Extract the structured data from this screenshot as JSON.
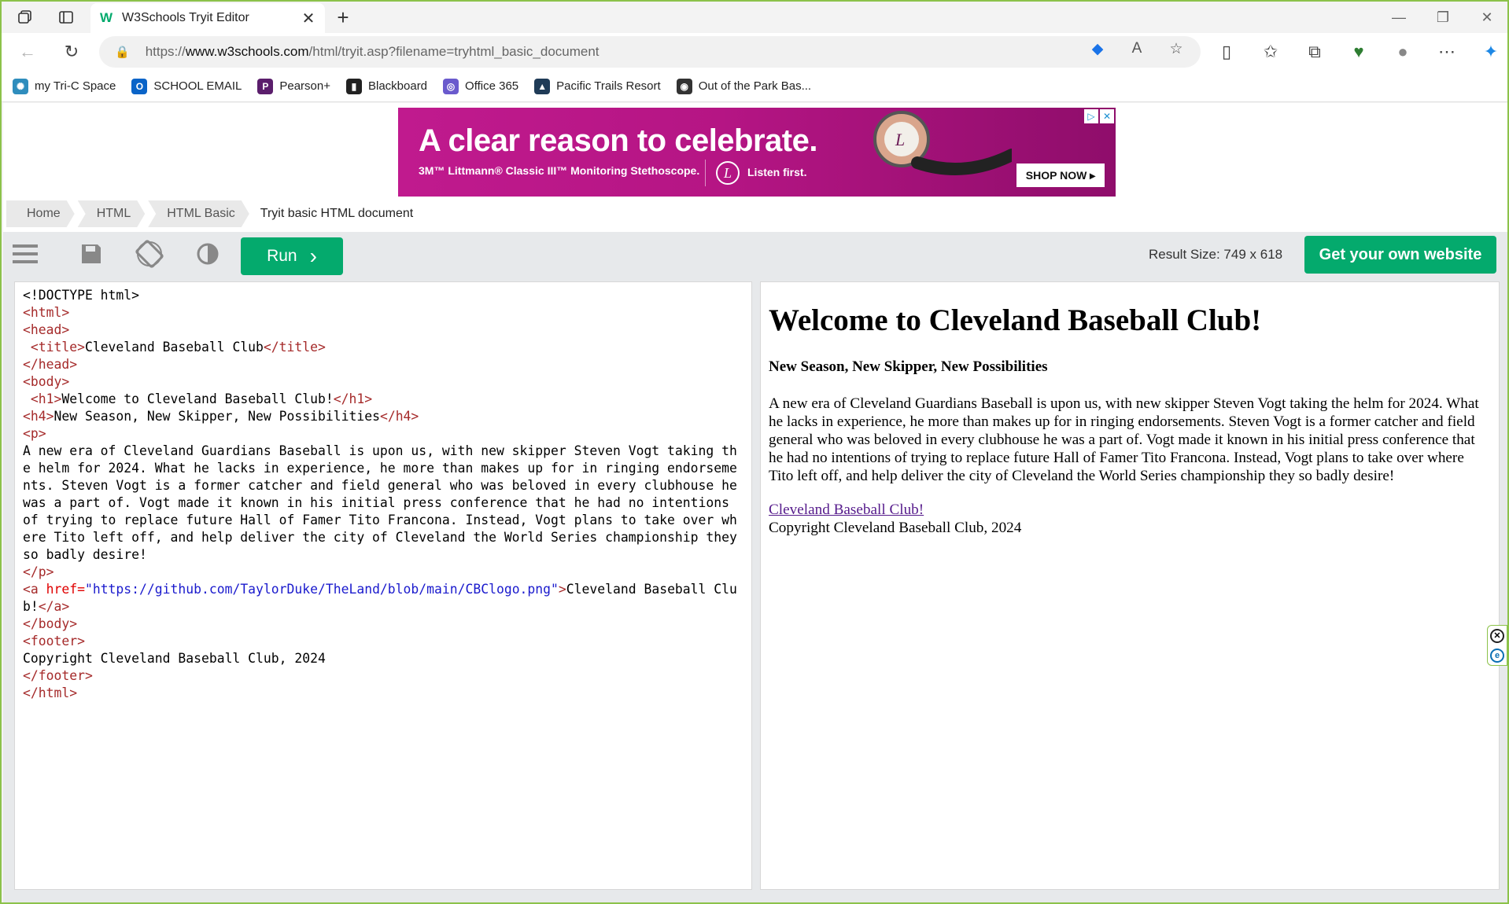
{
  "browser": {
    "tab_title": "W3Schools Tryit Editor",
    "tab_favicon": "W",
    "address": {
      "scheme": "https://",
      "host": "www.w3schools.com",
      "path": "/html/tryit.asp?filename=tryhtml_basic_document"
    },
    "favorites": [
      {
        "label": "my Tri-C Space",
        "icon": "tri-c-icon",
        "color": "#2f8dbd",
        "glyph": "✺"
      },
      {
        "label": "SCHOOL EMAIL",
        "icon": "outlook-icon",
        "color": "#0a64c8",
        "glyph": "O"
      },
      {
        "label": "Pearson+",
        "icon": "pearson-icon",
        "color": "#5b1e6c",
        "glyph": "P"
      },
      {
        "label": "Blackboard",
        "icon": "blackboard-icon",
        "color": "#222222",
        "glyph": "▮"
      },
      {
        "label": "Office 365",
        "icon": "office-icon",
        "color": "#6a5acd",
        "glyph": "◎"
      },
      {
        "label": "Pacific Trails Resort",
        "icon": "landscape-icon",
        "color": "#1f3b57",
        "glyph": "▲"
      },
      {
        "label": "Out of the Park Bas...",
        "icon": "baseball-icon",
        "color": "#333333",
        "glyph": "◉"
      }
    ]
  },
  "ad": {
    "headline": "A clear reason to celebrate.",
    "subline": "3M™ Littmann® Classic III™ Monitoring Stethoscope.",
    "logo_letter": "L",
    "listen": "Listen first.",
    "cta": "SHOP NOW ▸",
    "accent": "#c01a8e"
  },
  "breadcrumbs": [
    "Home",
    "HTML",
    "HTML Basic",
    "Tryit basic HTML document"
  ],
  "toolbar": {
    "run_label": "Run",
    "run_chevron": "›",
    "result_size": "Result Size: 749 x 618",
    "get_site_label": "Get your own website",
    "accent": "#04aa6d"
  },
  "editor_lines": [
    [
      {
        "t": "<!DOCTYPE html>"
      }
    ],
    [
      {
        "t": "<html>",
        "c": "tag"
      }
    ],
    [
      {
        "t": "<head>",
        "c": "tag"
      }
    ],
    [
      {
        "t": " "
      },
      {
        "t": "<title>",
        "c": "tag"
      },
      {
        "t": "Cleveland Baseball Club"
      },
      {
        "t": "</title>",
        "c": "tag"
      }
    ],
    [
      {
        "t": "</head>",
        "c": "tag"
      }
    ],
    [
      {
        "t": "<body>",
        "c": "tag"
      }
    ],
    [
      {
        "t": " "
      },
      {
        "t": "<h1>",
        "c": "tag"
      },
      {
        "t": "Welcome to Cleveland Baseball Club!"
      },
      {
        "t": "</h1>",
        "c": "tag"
      }
    ],
    [
      {
        "t": "<h4>",
        "c": "tag"
      },
      {
        "t": "New Season, New Skipper, New Possibilities"
      },
      {
        "t": "</h4>",
        "c": "tag"
      }
    ],
    [
      {
        "t": "<p>",
        "c": "tag"
      }
    ],
    [
      {
        "t": "A new era of Cleveland Guardians Baseball is upon us, with new skipper Steven Vogt taking the helm for 2024. What he lacks in experience, he more than makes up for in ringing endorsements. Steven Vogt is a former catcher and field general who was beloved in every clubhouse he was a part of. Vogt made it known in his initial press conference that he had no intentions of trying to replace future Hall of Famer Tito Francona. Instead, Vogt plans to take over where Tito left off, and help deliver the city of Cleveland the World Series championship they so badly desire!"
      }
    ],
    [
      {
        "t": "</p>",
        "c": "tag"
      }
    ],
    [
      {
        "t": "<a ",
        "c": "tag"
      },
      {
        "t": "href=",
        "c": "attr"
      },
      {
        "t": "\"https://github.com/TaylorDuke/TheLand/blob/main/CBClogo.png\"",
        "c": "str"
      },
      {
        "t": ">",
        "c": "tag"
      },
      {
        "t": "Cleveland Baseball Club!"
      },
      {
        "t": "</a>",
        "c": "tag"
      }
    ],
    [
      {
        "t": "</body>",
        "c": "tag"
      }
    ],
    [
      {
        "t": "<footer>",
        "c": "tag"
      }
    ],
    [
      {
        "t": "Copyright Cleveland Baseball Club, 2024"
      }
    ],
    [
      {
        "t": "</footer>",
        "c": "tag"
      }
    ],
    [
      {
        "t": "</html>",
        "c": "tag"
      }
    ]
  ],
  "result": {
    "h1": "Welcome to Cleveland Baseball Club!",
    "h4": "New Season, New Skipper, New Possibilities",
    "paragraph": "A new era of Cleveland Guardians Baseball is upon us, with new skipper Steven Vogt taking the helm for 2024. What he lacks in experience, he more than makes up for in ringing endorsements. Steven Vogt is a former catcher and field general who was beloved in every clubhouse he was a part of. Vogt made it known in his initial press conference that he had no intentions of trying to replace future Hall of Famer Tito Francona. Instead, Vogt plans to take over where Tito left off, and help deliver the city of Cleveland the World Series championship they so badly desire!",
    "link": "Cleveland Baseball Club!",
    "footer": "Copyright Cleveland Baseball Club, 2024"
  }
}
